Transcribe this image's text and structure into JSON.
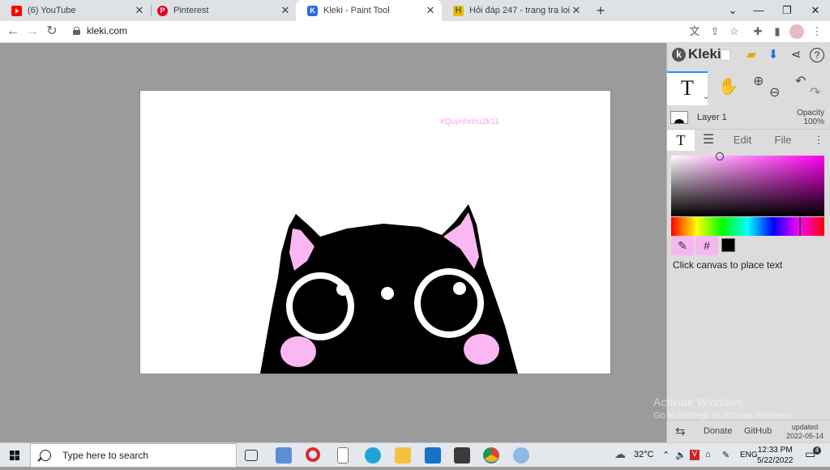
{
  "browser": {
    "tabs": [
      {
        "title": "(6) YouTube",
        "icon": "youtube-icon"
      },
      {
        "title": "Pinterest",
        "icon": "pinterest-icon"
      },
      {
        "title": "Kleki - Paint Tool",
        "icon": "kleki-icon",
        "active": true
      },
      {
        "title": "Hỏi đáp 247 - trang tra loi",
        "icon": "hoidap-icon"
      }
    ],
    "url": "kleki.com"
  },
  "canvas": {
    "watermark_text": "#Quynhnhu2k11",
    "bg_color": "#ffffff",
    "text_color": "#f6a3f1"
  },
  "panel": {
    "logo": "Kleki",
    "layer_name": "Layer 1",
    "opacity_label": "Opacity",
    "opacity_value": "100%",
    "tabs": {
      "edit": "Edit",
      "file": "File"
    },
    "hex_label": "#",
    "hint": "Click canvas to place text",
    "footer": {
      "donate": "Donate",
      "github": "GitHub",
      "updated_label": "updated",
      "updated_date": "2022-05-14"
    },
    "color_selected": "#000000",
    "hue_color": "#ff00f0"
  },
  "os_watermark": {
    "line1": "Activate Windows",
    "line2": "Go to Settings to activate Windows."
  },
  "taskbar": {
    "search_placeholder": "Type here to search",
    "temperature": "32°C",
    "language": "ENG",
    "time": "12:33 PM",
    "date": "5/22/2022",
    "notifications": "4"
  }
}
